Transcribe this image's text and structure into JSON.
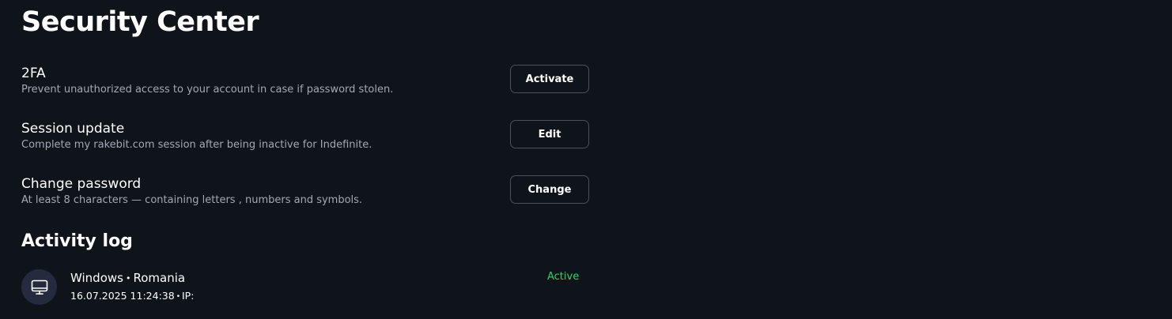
{
  "page": {
    "title": "Security Center"
  },
  "settings": [
    {
      "title": "2FA",
      "description": "Prevent unauthorized access to your account in case if password stolen.",
      "button_label": "Activate"
    },
    {
      "title": "Session update",
      "description": "Complete my rakebit.com session after being inactive for Indefinite.",
      "button_label": "Edit"
    },
    {
      "title": "Change password",
      "description": "At least 8 characters — containing letters , numbers and symbols.",
      "button_label": "Change"
    }
  ],
  "activity_log": {
    "title": "Activity log",
    "items": [
      {
        "icon": "monitor-icon",
        "os": "Windows",
        "location": "Romania",
        "separator": "•",
        "timestamp": "16.07.2025 11:24:38",
        "ip_label": "IP:",
        "status": "Active"
      }
    ]
  },
  "colors": {
    "background": "#0f131a",
    "text_primary": "#ffffff",
    "text_secondary": "#a4a8b3",
    "button_border": "#4a4f5a",
    "avatar_bg": "#252a3f",
    "status_active": "#2ed36a"
  }
}
